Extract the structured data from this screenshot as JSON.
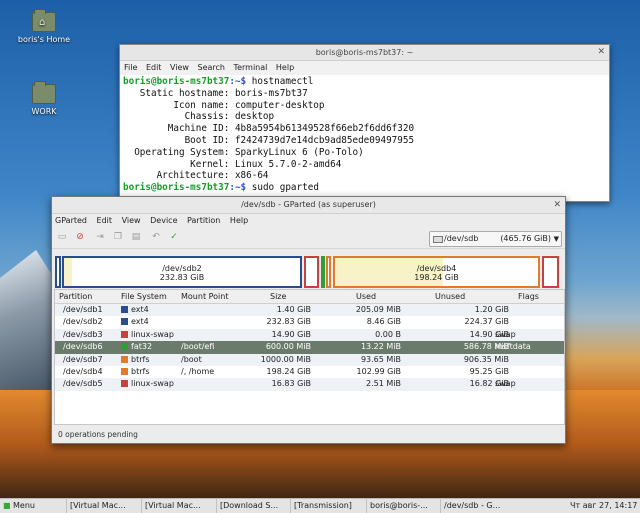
{
  "desktop": {
    "icons": [
      {
        "label": "boris's Home",
        "glyph": "⌂"
      },
      {
        "label": "WORK",
        "glyph": ""
      }
    ]
  },
  "terminal": {
    "title": "boris@boris-ms7bt37: ~",
    "menu": [
      "File",
      "Edit",
      "View",
      "Search",
      "Terminal",
      "Help"
    ],
    "prompt_user": "boris@boris-ms7bt37",
    "prompt_path": ":~$ ",
    "command1": "hostnamectl",
    "output": [
      "   Static hostname: boris-ms7bt37",
      "         Icon name: computer-desktop",
      "           Chassis: desktop",
      "        Machine ID: 4b8a5954b61349528f66eb2f6dd6f320",
      "           Boot ID: f2424739d7e14dcb9ad85ede09497955",
      "  Operating System: SparkyLinux 6 (Po-Tolo)",
      "            Kernel: Linux 5.7.0-2-amd64",
      "      Architecture: x86-64"
    ],
    "command2": "sudo gparted"
  },
  "gparted": {
    "title": "/dev/sdb - GParted (as superuser)",
    "menu": [
      "GParted",
      "Edit",
      "View",
      "Device",
      "Partition",
      "Help"
    ],
    "device": {
      "name": "/dev/sdb",
      "size": "(465.76 GiB)"
    },
    "map": {
      "sdb2": {
        "name": "/dev/sdb2",
        "size": "232.83 GiB"
      },
      "sdb4": {
        "name": "/dev/sdb4",
        "size": "198.24 GiB"
      }
    },
    "columns": [
      "Partition",
      "File System",
      "Mount Point",
      "Size",
      "Used",
      "Unused",
      "Flags"
    ],
    "rows": [
      {
        "partition": "/dev/sdb1",
        "fs": "ext4",
        "color": "#2a4d8f",
        "mount": "",
        "size": "1.40 GiB",
        "used": "205.09 MiB",
        "unused": "1.20 GiB",
        "flags": ""
      },
      {
        "partition": "/dev/sdb2",
        "fs": "ext4",
        "color": "#2a4d8f",
        "mount": "",
        "size": "232.83 GiB",
        "used": "8.46 GiB",
        "unused": "224.37 GiB",
        "flags": ""
      },
      {
        "partition": "/dev/sdb3",
        "fs": "linux-swap",
        "color": "#c84040",
        "mount": "",
        "size": "14.90 GiB",
        "used": "0.00 B",
        "unused": "14.90 GiB",
        "flags": "swap"
      },
      {
        "partition": "/dev/sdb6",
        "fs": "fat32",
        "color": "#2f9e3a",
        "mount": "/boot/efi",
        "size": "600.00 MiB",
        "used": "13.22 MiB",
        "unused": "586.78 MiB",
        "flags": "msftdata"
      },
      {
        "partition": "/dev/sdb7",
        "fs": "btrfs",
        "color": "#e07b2a",
        "mount": "/boot",
        "size": "1000.00 MiB",
        "used": "93.65 MiB",
        "unused": "906.35 MiB",
        "flags": ""
      },
      {
        "partition": "/dev/sdb4",
        "fs": "btrfs",
        "color": "#e07b2a",
        "mount": "/, /home",
        "size": "198.24 GiB",
        "used": "102.99 GiB",
        "unused": "95.25 GiB",
        "flags": ""
      },
      {
        "partition": "/dev/sdb5",
        "fs": "linux-swap",
        "color": "#c84040",
        "mount": "",
        "size": "16.83 GiB",
        "used": "2.51 MiB",
        "unused": "16.82 GiB",
        "flags": "swap"
      }
    ],
    "status": "0 operations pending"
  },
  "taskbar": {
    "menu": "Menu",
    "tasks": [
      "[Virtual Mac...",
      "[Virtual Mac...",
      "[Download S...",
      "[Transmission]",
      "boris@boris-...",
      "/dev/sdb - G..."
    ],
    "clock": "Чт авг 27, 14:17"
  }
}
